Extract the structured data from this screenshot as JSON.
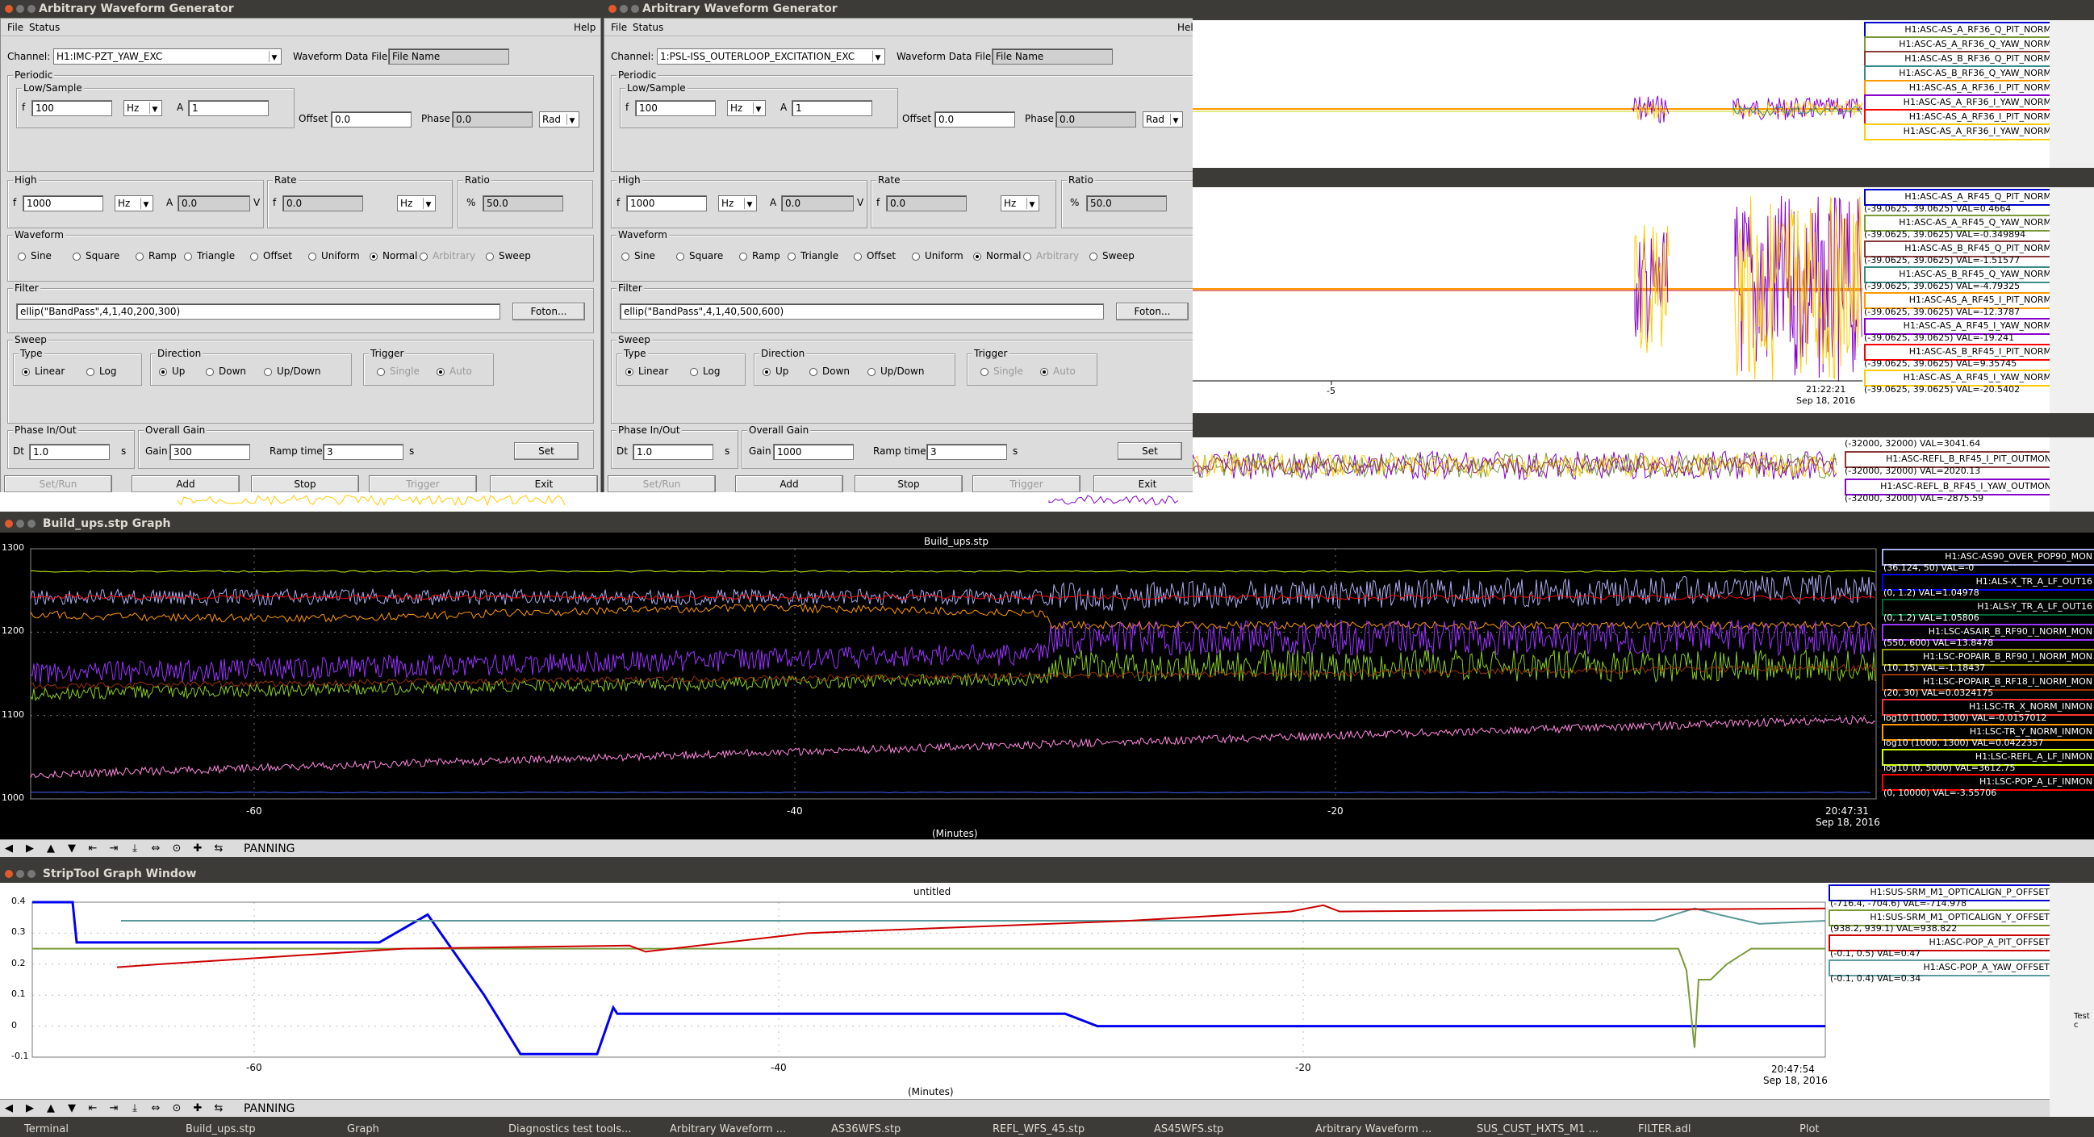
{
  "awg_windows": [
    {
      "title": "Arbitrary Waveform Generator",
      "menu": {
        "file": "File",
        "status": "Status",
        "help": "Help"
      },
      "channel_label": "Channel:",
      "channel_value": "H1:IMC-PZT_YAW_EXC",
      "wdf_label": "Waveform Data File:",
      "wdf_value": "File Name",
      "periodic": {
        "label": "Periodic",
        "low_label": "Low/Sample",
        "f": "100",
        "f_unit": "Hz",
        "a": "1",
        "offset_label": "Offset",
        "offset": "0.0",
        "phase_label": "Phase",
        "phase": "0.0",
        "phase_unit": "Rad"
      },
      "high": {
        "label": "High",
        "f": "1000",
        "f_unit": "Hz",
        "a": "0.0",
        "a_unit": "V"
      },
      "rate": {
        "label": "Rate",
        "f": "0.0",
        "unit": "Hz"
      },
      "ratio": {
        "label": "Ratio",
        "pct": "%",
        "value": "50.0"
      },
      "waveform": {
        "label": "Waveform",
        "options": [
          "Sine",
          "Square",
          "Ramp",
          "Triangle",
          "Offset",
          "Uniform",
          "Normal",
          "Arbitrary",
          "Sweep"
        ],
        "selected": "Normal"
      },
      "filter": {
        "label": "Filter",
        "value": "ellip(\"BandPass\",4,1,40,200,300)",
        "button": "Foton..."
      },
      "sweep": {
        "label": "Sweep",
        "type_label": "Type",
        "linear": "Linear",
        "log": "Log",
        "dir_label": "Direction",
        "up": "Up",
        "down": "Down",
        "updown": "Up/Down",
        "trig_label": "Trigger",
        "single": "Single",
        "auto": "Auto"
      },
      "phase_inout": {
        "label": "Phase In/Out",
        "dt_label": "Dt",
        "dt": "1.0",
        "unit": "s"
      },
      "overall": {
        "label": "Overall Gain",
        "gain_label": "Gain",
        "gain": "300",
        "ramp_label": "Ramp time",
        "ramp": "3",
        "unit": "s",
        "set": "Set"
      },
      "buttons": {
        "setrun": "Set/Run",
        "add": "Add",
        "stop": "Stop",
        "trigger": "Trigger",
        "exit": "Exit"
      }
    },
    {
      "title": "Arbitrary Waveform Generator",
      "menu": {
        "file": "File",
        "status": "Status",
        "help": "Help"
      },
      "channel_label": "Channel:",
      "channel_value": "1:PSL-ISS_OUTERLOOP_EXCITATION_EXC",
      "wdf_label": "Waveform Data File:",
      "wdf_value": "File Name",
      "periodic": {
        "label": "Periodic",
        "low_label": "Low/Sample",
        "f": "100",
        "f_unit": "Hz",
        "a": "1",
        "offset_label": "Offset",
        "offset": "0.0",
        "phase_label": "Phase",
        "phase": "0.0",
        "phase_unit": "Rad"
      },
      "high": {
        "label": "High",
        "f": "1000",
        "f_unit": "Hz",
        "a": "0.0",
        "a_unit": "V"
      },
      "rate": {
        "label": "Rate",
        "f": "0.0",
        "unit": "Hz"
      },
      "ratio": {
        "label": "Ratio",
        "pct": "%",
        "value": "50.0"
      },
      "waveform": {
        "label": "Waveform",
        "options": [
          "Sine",
          "Square",
          "Ramp",
          "Triangle",
          "Offset",
          "Uniform",
          "Normal",
          "Arbitrary",
          "Sweep"
        ],
        "selected": "Normal"
      },
      "filter": {
        "label": "Filter",
        "value": "ellip(\"BandPass\",4,1,40,500,600)",
        "button": "Foton..."
      },
      "sweep": {
        "label": "Sweep",
        "type_label": "Type",
        "linear": "Linear",
        "log": "Log",
        "dir_label": "Direction",
        "up": "Up",
        "down": "Down",
        "updown": "Up/Down",
        "trig_label": "Trigger",
        "single": "Single",
        "auto": "Auto"
      },
      "phase_inout": {
        "label": "Phase In/Out",
        "dt_label": "Dt",
        "dt": "1.0",
        "unit": "s"
      },
      "overall": {
        "label": "Overall Gain",
        "gain_label": "Gain",
        "gain": "1000",
        "ramp_label": "Ramp time",
        "ramp": "3",
        "unit": "s",
        "set": "Set"
      },
      "buttons": {
        "setrun": "Set/Run",
        "add": "Add",
        "stop": "Stop",
        "trigger": "Trigger",
        "exit": "Exit"
      }
    }
  ],
  "as36": {
    "legend": [
      {
        "name": "H1:ASC-AS_A_RF36_Q_PIT_NORM",
        "color": "#0000cc"
      },
      {
        "name": "H1:ASC-AS_A_RF36_Q_YAW_NORM",
        "color": "#7a9a3a"
      },
      {
        "name": "H1:ASC-AS_B_RF36_Q_PIT_NORM",
        "color": "#8b3a3a"
      },
      {
        "name": "H1:ASC-AS_B_RF36_Q_YAW_NORM",
        "color": "#3a8a8a"
      },
      {
        "name": "H1:ASC-AS_A_RF36_I_PIT_NORM",
        "color": "#ff9900"
      },
      {
        "name": "H1:ASC-AS_A_RF36_I_YAW_NORM",
        "color": "#8800cc"
      },
      {
        "name": "H1:ASC-AS_A_RF36_I_PIT_NORM",
        "color": "#ff0000"
      },
      {
        "name": "H1:ASC-AS_A_RF36_I_YAW_NORM",
        "color": "#ffcc00"
      }
    ]
  },
  "as45": {
    "legend": [
      {
        "name": "H1:ASC-AS_A_RF45_Q_PIT_NORM",
        "val": "",
        "color": "#0000cc"
      },
      {
        "name": "H1:ASC-AS_A_RF45_Q_YAW_NORM",
        "val": "(-39.0625, 39.0625) VAL=0.4664",
        "color": "#7a9a3a"
      },
      {
        "name": "H1:ASC-AS_B_RF45_Q_PIT_NORM",
        "val": "(-39.0625, 39.0625) VAL=-0.349894",
        "color": "#8b3a3a"
      },
      {
        "name": "H1:ASC-AS_B_RF45_Q_YAW_NORM",
        "val": "(-39.0625, 39.0625) VAL=-1.51577",
        "color": "#3a8a8a"
      },
      {
        "name": "H1:ASC-AS_A_RF45_I_PIT_NORM",
        "val": "(-39.0625, 39.0625) VAL=-4.79325",
        "color": "#ff9900"
      },
      {
        "name": "H1:ASC-AS_A_RF45_I_YAW_NORM",
        "val": "(-39.0625, 39.0625) VAL=-12.3787",
        "color": "#8800cc"
      },
      {
        "name": "H1:ASC-AS_B_RF45_I_PIT_NORM",
        "val": "(-39.0625, 39.0625) VAL=-19.241",
        "color": "#ff0000"
      },
      {
        "name": "H1:ASC-AS_A_RF45_I_YAW_NORM",
        "val": "(-39.0625, 39.0625) VAL=9.35745",
        "color": "#ffcc00"
      }
    ],
    "last_val": "(-39.0625, 39.0625) VAL=-20.5402",
    "xtick": "-5",
    "time": "21:22:21",
    "date": "Sep 18, 2016"
  },
  "refl": {
    "legend": [
      {
        "text": "(-32000, 32000) VAL=3041.64",
        "color": ""
      },
      {
        "text": "H1:ASC-REFL_B_RF45_I_PIT_OUTMON",
        "color": "#8b3a3a"
      },
      {
        "text": "(-32000, 32000) VAL=2020.13",
        "color": ""
      },
      {
        "text": "H1:ASC-REFL_B_RF45_I_YAW_OUTMON",
        "color": "#8800cc"
      },
      {
        "text": "(-32000, 32000) VAL=-2875.59",
        "color": ""
      }
    ]
  },
  "build_ups": {
    "window_title": "Build_ups.stp Graph",
    "plot_title": "Build_ups.stp",
    "yticks": [
      "1300",
      "1200",
      "1100",
      "1000"
    ],
    "xticks": [
      "-60",
      "-40",
      "-20"
    ],
    "xlabel": "(Minutes)",
    "time": "20:47:31",
    "date": "Sep 18, 2016",
    "legend": [
      {
        "name": "H1:ASC-AS90_OVER_POP90_MON",
        "val": "(36.124, 50) VAL=-0",
        "color": "#aaaaee"
      },
      {
        "name": "H1:ALS-X_TR_A_LF_OUT16",
        "val": "(0, 1.2) VAL=1.04978",
        "color": "#0000ff"
      },
      {
        "name": "H1:ALS-Y_TR_A_LF_OUT16",
        "val": "(0, 1.2) VAL=1.05806",
        "color": "#006633"
      },
      {
        "name": "H1:LSC-ASAIR_B_RF90_I_NORM_MON",
        "val": "(550, 600) VAL=13.8478",
        "color": "#9933ff"
      },
      {
        "name": "H1:LSC-POPAIR_B_RF90_I_NORM_MON",
        "val": "(10, 15) VAL=-1.18437",
        "color": "#999900"
      },
      {
        "name": "H1:LSC-POPAIR_B_RF18_I_NORM_MON",
        "val": "(20, 30) VAL=0.0324175",
        "color": "#993300"
      },
      {
        "name": "H1:LSC-TR_X_NORM_INMON",
        "val": "log10 (1000, 1300) VAL=-0.0157012",
        "color": "#ff3333"
      },
      {
        "name": "H1:LSC-TR_Y_NORM_INMON",
        "val": "log10 (1000, 1300) VAL=0.0422357",
        "color": "#ff9900"
      },
      {
        "name": "H1:LSC-REFL_A_LF_INMON",
        "val": "log10 (0, 5000) VAL=3612.75",
        "color": "#ccff00"
      },
      {
        "name": "H1:LSC-POP_A_LF_INMON",
        "val": "(0, 10000) VAL=-3.55706",
        "color": "#ff0000"
      }
    ],
    "toolbar_mode": "PANNING"
  },
  "strip": {
    "window_title": "StripTool Graph Window",
    "plot_title": "untitled",
    "yticks": [
      "0.4",
      "0.3",
      "0.2",
      "0.1",
      "0",
      "-0.1"
    ],
    "xticks": [
      "-60",
      "-40",
      "-20"
    ],
    "xlabel": "(Minutes)",
    "time": "20:47:54",
    "date": "Sep 18, 2016",
    "legend": [
      {
        "name": "H1:SUS-SRM_M1_OPTICALIGN_P_OFFSET",
        "val": "(-716.4, -704.6) VAL=-714.978",
        "color": "#0000cc"
      },
      {
        "name": "H1:SUS-SRM_M1_OPTICALIGN_Y_OFFSET",
        "val": "(938.2, 939.1) VAL=938.822",
        "color": "#7a9a3a"
      },
      {
        "name": "H1:ASC-POP_A_PIT_OFFSET",
        "val": "(-0.1, 0.5) VAL=0.47",
        "color": "#cc0000"
      },
      {
        "name": "H1:ASC-POP_A_YAW_OFFSET",
        "val": "(-0.1, 0.4) VAL=0.34",
        "color": "#5a9a9a"
      }
    ],
    "toolbar_mode": "PANNING"
  },
  "side": {
    "label": "Test c"
  },
  "taskbar": [
    "Terminal",
    "Build_ups.stp",
    "Graph",
    "Diagnostics test tools...",
    "Arbitrary Waveform ...",
    "AS36WFS.stp",
    "REFL_WFS_45.stp",
    "AS45WFS.stp",
    "Arbitrary Waveform ...",
    "SUS_CUST_HXTS_M1 ...",
    "FILTER.adl",
    "Plot"
  ]
}
